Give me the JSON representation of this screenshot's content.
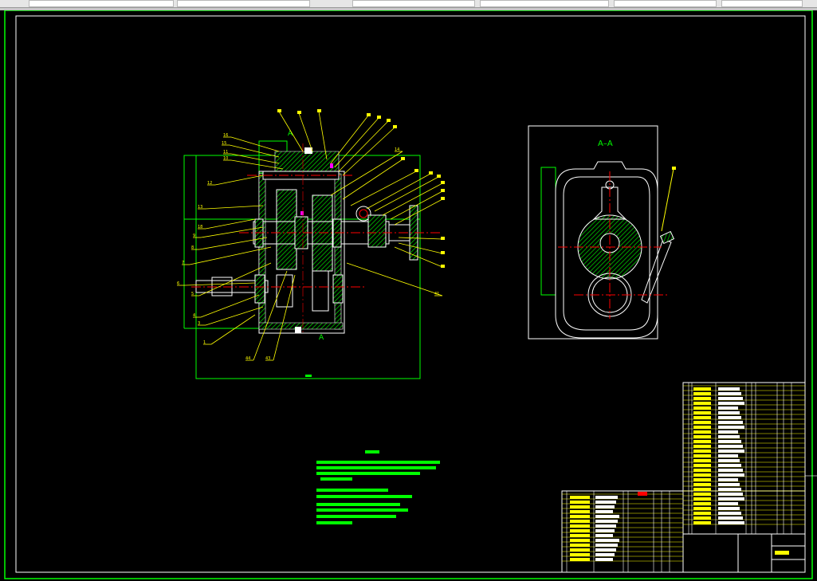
{
  "toolbar": {
    "fields": 6
  },
  "colors": {
    "background": "#000000",
    "border": "#00ff00",
    "frame": "#ffffff",
    "outline": "#ffffff",
    "hatch": "#00c800",
    "leader": "#ffff00",
    "centerline": "#ff0000",
    "dimension": "#00ff00",
    "highlight": "#ff00ff"
  },
  "main_view": {
    "section_marker_top": "A",
    "section_marker_bottom": "A",
    "leader_labels": [
      "16",
      "15",
      "11",
      "10",
      "12",
      "13",
      "18",
      "9",
      "8",
      "7",
      "6",
      "5",
      "4",
      "3",
      "1",
      "44",
      "43",
      "14",
      "41"
    ]
  },
  "section_view": {
    "title": "A–A"
  }
}
